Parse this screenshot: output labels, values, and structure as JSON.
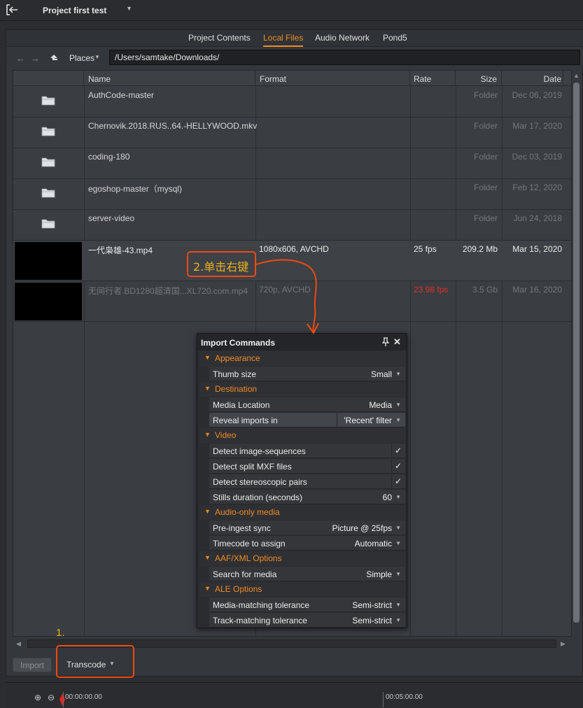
{
  "titlebar": {
    "project_title": "Project first test",
    "caret": "▼"
  },
  "tabs": [
    {
      "label": "Project Contents",
      "active": false
    },
    {
      "label": "Local Files",
      "active": true
    },
    {
      "label": "Audio Network",
      "active": false
    },
    {
      "label": "Pond5",
      "active": false
    }
  ],
  "pathbar": {
    "places_label": "Places",
    "places_caret": "▼",
    "path": "/Users/samtake/Downloads/"
  },
  "table": {
    "columns": [
      "Name",
      "Format",
      "Rate",
      "Size",
      "Date"
    ],
    "rows": [
      {
        "name": "AuthCode-master",
        "format": "",
        "rate": "",
        "size": "Folder",
        "date": "Dec 06, 2019",
        "kind": "folder"
      },
      {
        "name": "Chernovik.2018.RUS..64.-HELLYWOOD.mkv",
        "format": "",
        "rate": "",
        "size": "Folder",
        "date": "Mar 17, 2020",
        "kind": "folder"
      },
      {
        "name": "coding-180",
        "format": "",
        "rate": "",
        "size": "Folder",
        "date": "Dec 03, 2019",
        "kind": "folder"
      },
      {
        "name": "egoshop-master（mysql)",
        "format": "",
        "rate": "",
        "size": "Folder",
        "date": "Feb 12, 2020",
        "kind": "folder"
      },
      {
        "name": "server-video",
        "format": "",
        "rate": "",
        "size": "Folder",
        "date": "Jun 24, 2018",
        "kind": "folder"
      },
      {
        "name": "一代枭雄-43.mp4",
        "format": "1080x606, AVCHD",
        "rate": "25 fps",
        "size": "209.2 Mb",
        "date": "Mar 15, 2020",
        "kind": "video"
      },
      {
        "name": "无间行者.BD1280超清国...XL720.com.mp4",
        "format": "720p, AVCHD",
        "rate": "23.98 fps",
        "size": "3.5 Gb",
        "date": "Mar 16, 2020",
        "kind": "video-dim"
      }
    ]
  },
  "buttons": {
    "import": "Import",
    "transcode": "Transcode",
    "transcode_caret": "▼"
  },
  "timeline": {
    "time_start": "00:00:00.00",
    "time_mark": "00:05:00.00"
  },
  "popup": {
    "title": "Import Commands",
    "pin": "📌",
    "close": "✕",
    "sections": {
      "appearance": "Appearance",
      "destination": "Destination",
      "video": "Video",
      "audio_only": "Audio-only media",
      "aaf_xml": "AAF/XML Options",
      "ale": "ALE Options"
    },
    "items": {
      "thumb_size": {
        "label": "Thumb size",
        "value": "Small"
      },
      "media_location": {
        "label": "Media Location",
        "value": "Media"
      },
      "reveal_imports": {
        "label": "Reveal imports in",
        "value": "'Recent' filter"
      },
      "detect_image_seq": {
        "label": "Detect image-sequences",
        "value": "✓"
      },
      "detect_split_mxf": {
        "label": "Detect split MXF files",
        "value": "✓"
      },
      "detect_stereo": {
        "label": "Detect stereoscopic pairs",
        "value": "✓"
      },
      "stills_duration": {
        "label": "Stills duration (seconds)",
        "value": "60"
      },
      "pre_ingest_sync": {
        "label": "Pre-ingest sync",
        "value": "Picture @ 25fps"
      },
      "timecode_assign": {
        "label": "Timecode to assign",
        "value": "Automatic"
      },
      "search_media": {
        "label": "Search for media",
        "value": "Simple"
      },
      "media_match_tol": {
        "label": "Media-matching tolerance",
        "value": "Semi-strict"
      },
      "track_match_tol": {
        "label": "Track-matching tolerance",
        "value": "Semi-strict"
      }
    }
  },
  "annotations": {
    "step1": "1.",
    "step2": "2.单击右键"
  },
  "colors": {
    "accent": "#f08a24",
    "annotation_border": "#f04a0f",
    "annotation_text": "#e8b11c",
    "rate_warning": "#e0302a"
  }
}
